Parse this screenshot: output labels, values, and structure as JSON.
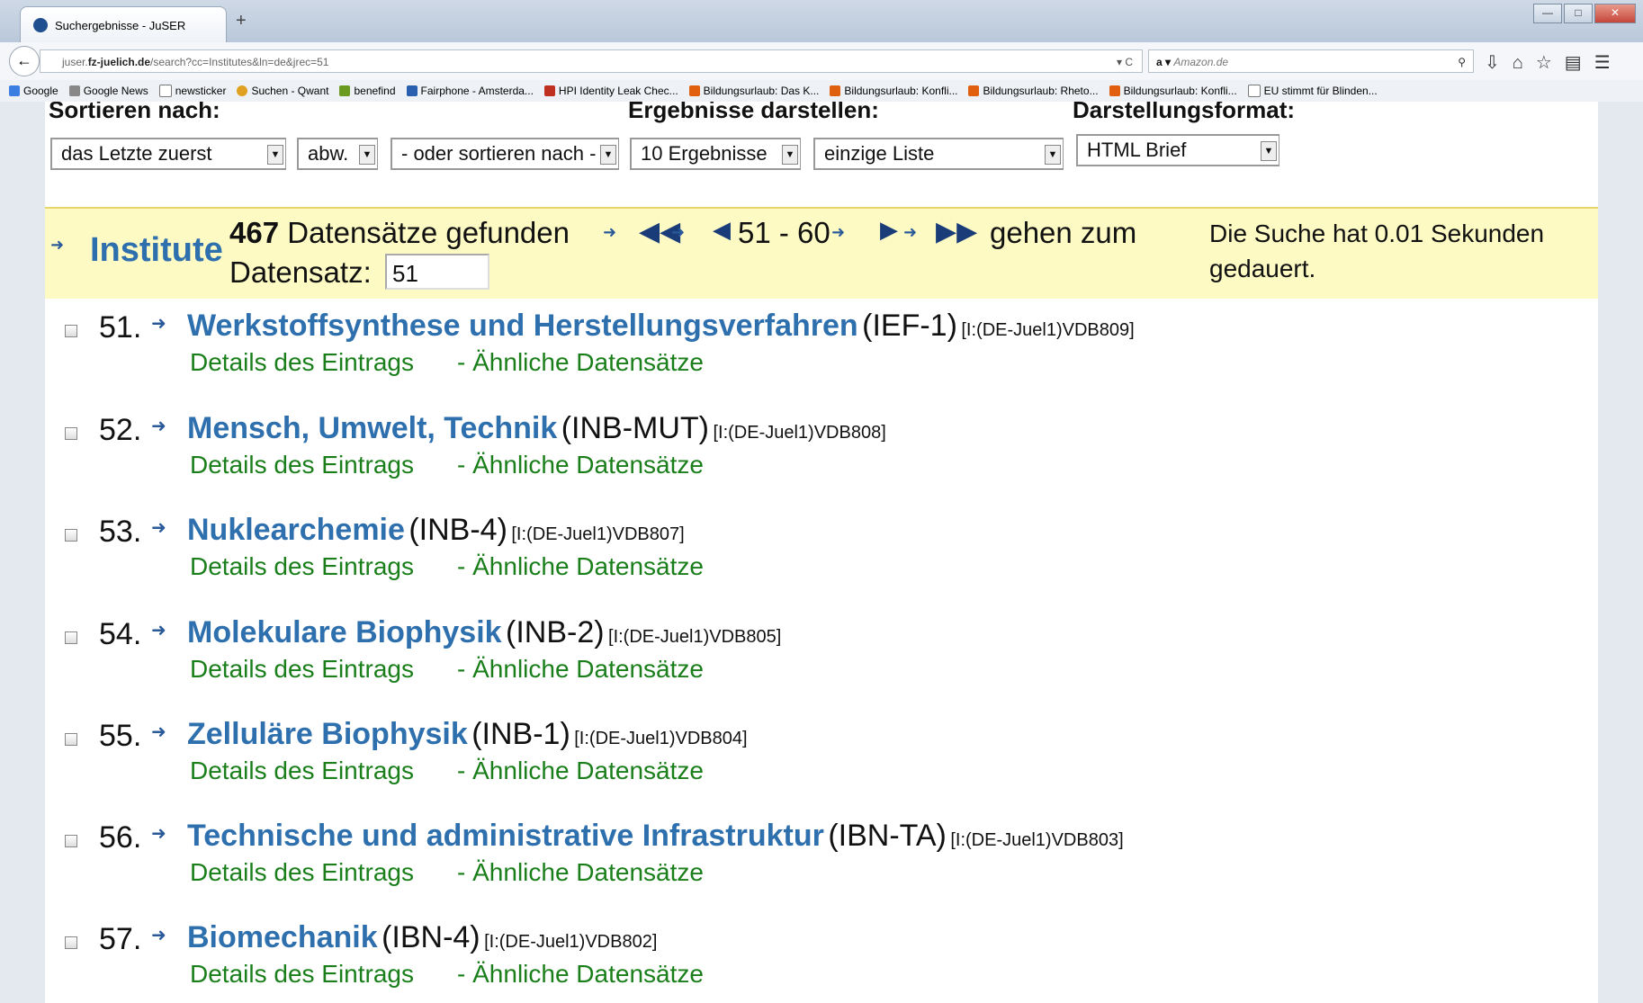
{
  "browser": {
    "tab_title": "Suchergebnisse - JuSER",
    "new_tab_label": "+",
    "url_prefix": "juser.",
    "url_domain": "fz-juelich.de",
    "url_path": "/search?cc=Institutes&ln=de&jrec=51",
    "search_placeholder": "Amazon.de",
    "bookmarks": [
      "Google",
      "Google News",
      "newsticker",
      "Suchen - Qwant",
      "benefind",
      "Fairphone - Amsterda...",
      "HPI Identity Leak Chec...",
      "Bildungsurlaub: Das K...",
      "Bildungsurlaub: Konfli...",
      "Bildungsurlaub: Rheto...",
      "Bildungsurlaub: Konfli...",
      "EU stimmt für Blinden..."
    ]
  },
  "controls": {
    "sort_label": "Sortieren nach:",
    "display_label": "Ergebnisse darstellen:",
    "format_label": "Darstellungsformat:",
    "sort_order": "das Letzte zuerst",
    "direction": "abw.",
    "sort_by": "- oder sortieren nach -",
    "per_page": "10 Ergebnisse",
    "list_type": "einzige Liste",
    "format": "HTML Brief"
  },
  "banner": {
    "collection": "Institute",
    "count": "467",
    "found_text": "Datensätze gefunden",
    "range": "51 - 60",
    "goto_text": "gehen zum",
    "record_label": "Datensatz:",
    "record_value": "51",
    "timing": "Die Suche hat 0.01 Sekunden gedauert."
  },
  "record_links": {
    "details": "Details des Eintrags",
    "similar": "- Ähnliche Datensätze"
  },
  "records": [
    {
      "num": "51.",
      "title": "Werkstoffsynthese und Herstellungsverfahren",
      "code": "(IEF-1)",
      "id": "[I:(DE-Juel1)VDB809]"
    },
    {
      "num": "52.",
      "title": "Mensch, Umwelt, Technik",
      "code": "(INB-MUT)",
      "id": "[I:(DE-Juel1)VDB808]"
    },
    {
      "num": "53.",
      "title": "Nuklearchemie",
      "code": "(INB-4)",
      "id": "[I:(DE-Juel1)VDB807]"
    },
    {
      "num": "54.",
      "title": "Molekulare Biophysik",
      "code": "(INB-2)",
      "id": "[I:(DE-Juel1)VDB805]"
    },
    {
      "num": "55.",
      "title": "Zelluläre Biophysik",
      "code": "(INB-1)",
      "id": "[I:(DE-Juel1)VDB804]"
    },
    {
      "num": "56.",
      "title": "Technische und administrative Infrastruktur",
      "code": "(IBN-TA)",
      "id": "[I:(DE-Juel1)VDB803]"
    },
    {
      "num": "57.",
      "title": "Biomechanik",
      "code": "(IBN-4)",
      "id": "[I:(DE-Juel1)VDB802]"
    }
  ]
}
